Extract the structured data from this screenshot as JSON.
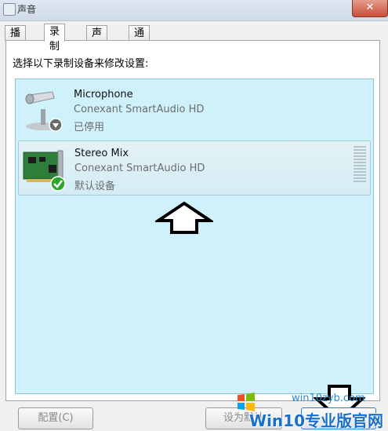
{
  "window": {
    "title": "声音",
    "close_symbol": "✕"
  },
  "tabs": [
    {
      "label": "播放"
    },
    {
      "label": "录制",
      "active": true
    },
    {
      "label": "声音"
    },
    {
      "label": "通信"
    }
  ],
  "prompt": "选择以下录制设备来修改设置:",
  "devices": [
    {
      "name": "Microphone",
      "driver": "Conexant SmartAudio HD",
      "status": "已停用",
      "icon": "microphone-icon",
      "badge": "disabled-arrow-badge"
    },
    {
      "name": "Stereo Mix",
      "driver": "Conexant SmartAudio HD",
      "status": "默认设备",
      "icon": "sound-card-icon",
      "badge": "default-check-badge",
      "selected": true
    }
  ],
  "buttons": {
    "configure": "配置(C)",
    "set_default": "设为默认"
  },
  "watermark": {
    "brand": "Win10专业版官网",
    "url": "win10zyb.com"
  },
  "colors": {
    "list_bg": "#cff1fb",
    "selection": "#d4ecf3",
    "check": "#2fa52f"
  }
}
